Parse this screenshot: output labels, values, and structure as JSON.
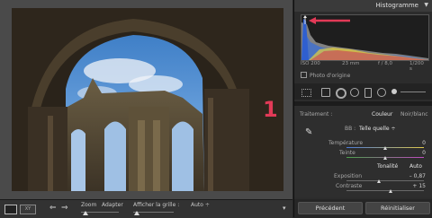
{
  "annotation": {
    "number": "1"
  },
  "toolbar": {
    "zoom_label": "Zoom",
    "adapter_label": "Adapter",
    "grid_label": "Afficher la grille :",
    "grid_value": "Auto ÷"
  },
  "histogram": {
    "title": "Histogramme",
    "camera": {
      "iso": "ISO 200",
      "focal": "23 mm",
      "aperture": "f / 8,0",
      "shutter": "1/200 s"
    },
    "original_photo_label": "Photo d'origine"
  },
  "settings": {
    "traitement_label": "Traitement :",
    "traitement_options": [
      "Couleur",
      "Noir/blanc"
    ],
    "wb_label": "BB :",
    "wb_value": "Telle quelle ÷",
    "temperature": {
      "label": "Température",
      "value": "0",
      "level": 0.5
    },
    "teinte": {
      "label": "Teinte",
      "value": "0",
      "level": 0.5
    },
    "tonalite_label": "Tonalité",
    "auto_label": "Auto",
    "exposition": {
      "label": "Exposition",
      "value": "– 0,87",
      "level": 0.43
    },
    "contraste": {
      "label": "Contraste",
      "value": "+ 15",
      "level": 0.57
    }
  },
  "buttons": {
    "previous": "Précédent",
    "reset": "Réinitialiser"
  },
  "colors": {
    "annotation": "#e23a57",
    "arrow": "#e23a57"
  }
}
